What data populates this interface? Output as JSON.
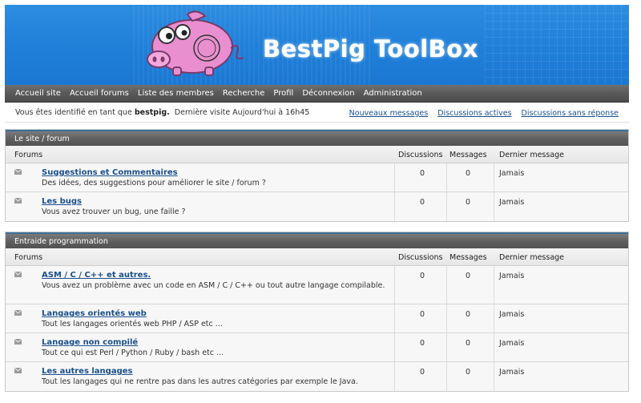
{
  "banner": {
    "title": "BestPig ToolBox",
    "logo_icon": "pig-mascot-icon"
  },
  "nav": {
    "items": [
      "Accueil site",
      "Accueil forums",
      "Liste des membres",
      "Recherche",
      "Profil",
      "Déconnexion",
      "Administration"
    ]
  },
  "status": {
    "prefix": "Vous êtes identifié en tant que",
    "user": "bestpig.",
    "last_visit": "Dernière visite Aujourd'hui à 16h45",
    "links": [
      "Nouveaux messages",
      "Discussions actives",
      "Discussions sans réponse"
    ]
  },
  "columns": {
    "forums": "Forums",
    "discussions": "Discussions",
    "messages": "Messages",
    "last": "Dernier message"
  },
  "sections": [
    {
      "title": "Le site / forum",
      "forums": [
        {
          "title": "Suggestions et Commentaires",
          "desc": "Des idées, des suggestions pour améliorer le site / forum  ?",
          "discussions": "0",
          "messages": "0",
          "last": "Jamais"
        },
        {
          "title": "Les bugs",
          "desc": "Vous avez trouver un bug, une faille  ?",
          "discussions": "0",
          "messages": "0",
          "last": "Jamais"
        }
      ]
    },
    {
      "title": "Entraide programmation",
      "forums": [
        {
          "title": "ASM / C / C++ et autres.",
          "desc": "Vous avez un problème avec un code en ASM / C / C++ ou tout autre langage compilable.",
          "discussions": "0",
          "messages": "0",
          "last": "Jamais"
        },
        {
          "title": "Langages orientés web",
          "desc": "Tout les langages orientés web PHP / ASP etc ...",
          "discussions": "0",
          "messages": "0",
          "last": "Jamais"
        },
        {
          "title": "Langage non compilé",
          "desc": "Tout ce qui est Perl / Python / Ruby / bash etc ...",
          "discussions": "0",
          "messages": "0",
          "last": "Jamais"
        },
        {
          "title": "Les autres langages",
          "desc": "Tout les langages qui ne rentre pas dans les autres catégories par exemple le Java.",
          "discussions": "0",
          "messages": "0",
          "last": "Jamais"
        }
      ]
    }
  ],
  "colors": {
    "link": "#1b4f8c",
    "banner": "#1f7fd9",
    "nav": "#595959"
  }
}
